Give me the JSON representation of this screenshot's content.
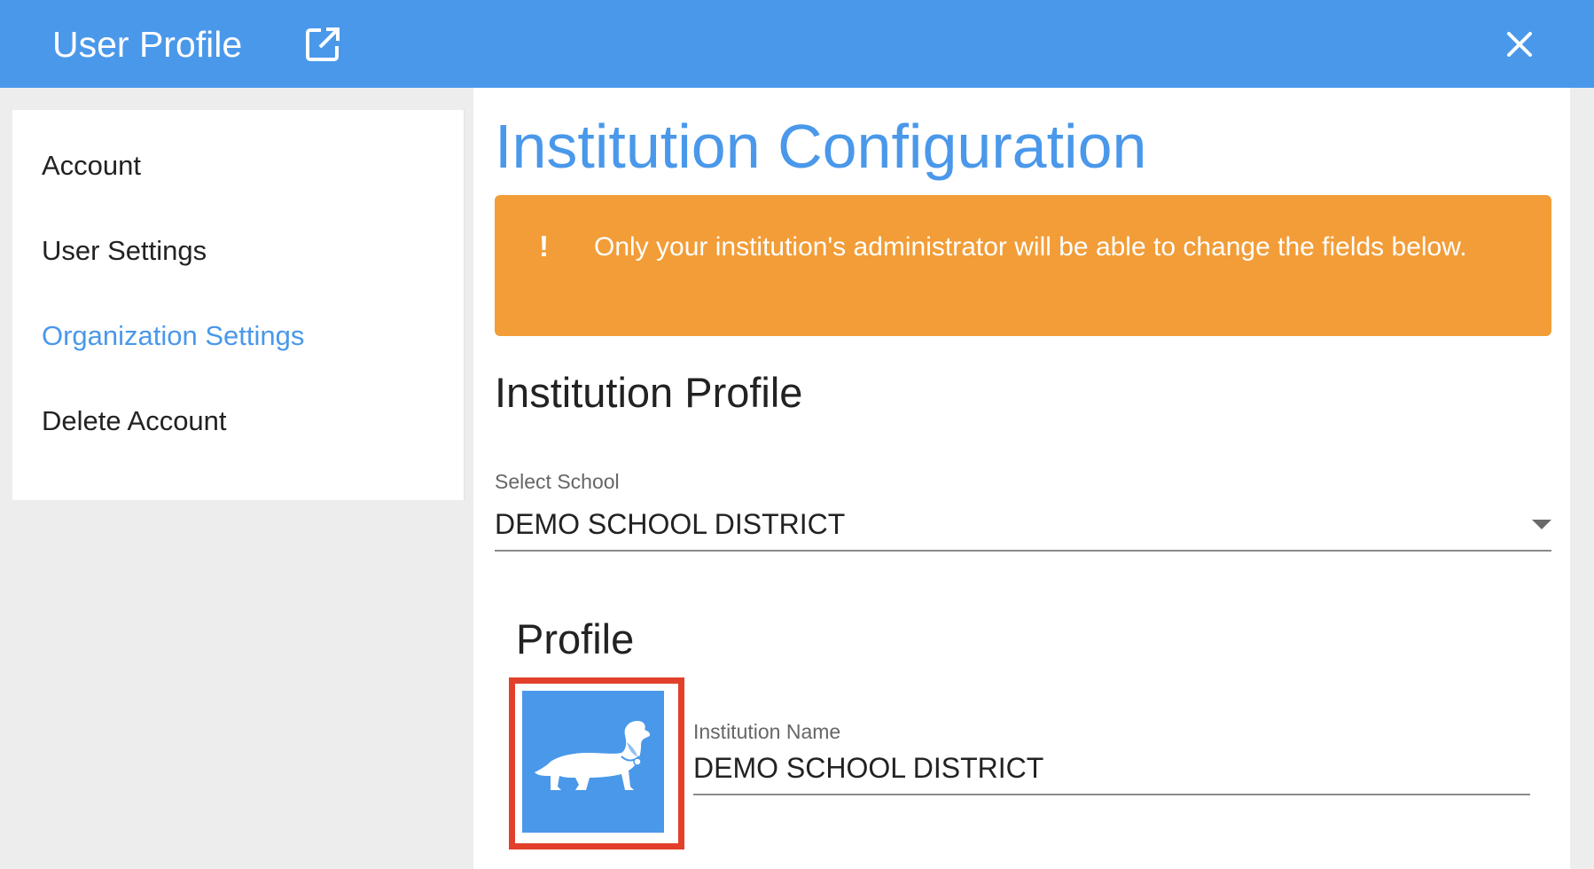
{
  "window": {
    "title": "User Profile",
    "popout_icon": "external-link-icon",
    "close_icon": "close-icon"
  },
  "sidebar": {
    "items": [
      {
        "label": "Account",
        "active": false
      },
      {
        "label": "User Settings",
        "active": false
      },
      {
        "label": "Organization Settings",
        "active": true
      },
      {
        "label": "Delete Account",
        "active": false
      }
    ]
  },
  "main": {
    "page_title": "Institution Configuration",
    "alert": {
      "icon": "!",
      "text": "Only your institution's administrator will be able to change the fields below."
    },
    "section_title": "Institution Profile",
    "select_school": {
      "label": "Select School",
      "value": "DEMO SCHOOL DISTRICT"
    },
    "profile": {
      "title": "Profile",
      "logo_icon": "dachshund-dog-icon",
      "institution_name_label": "Institution Name",
      "institution_name_value": "DEMO SCHOOL DISTRICT"
    }
  },
  "colors": {
    "accent": "#4a98ea",
    "warning": "#f29d38",
    "highlight": "#e2402b"
  }
}
